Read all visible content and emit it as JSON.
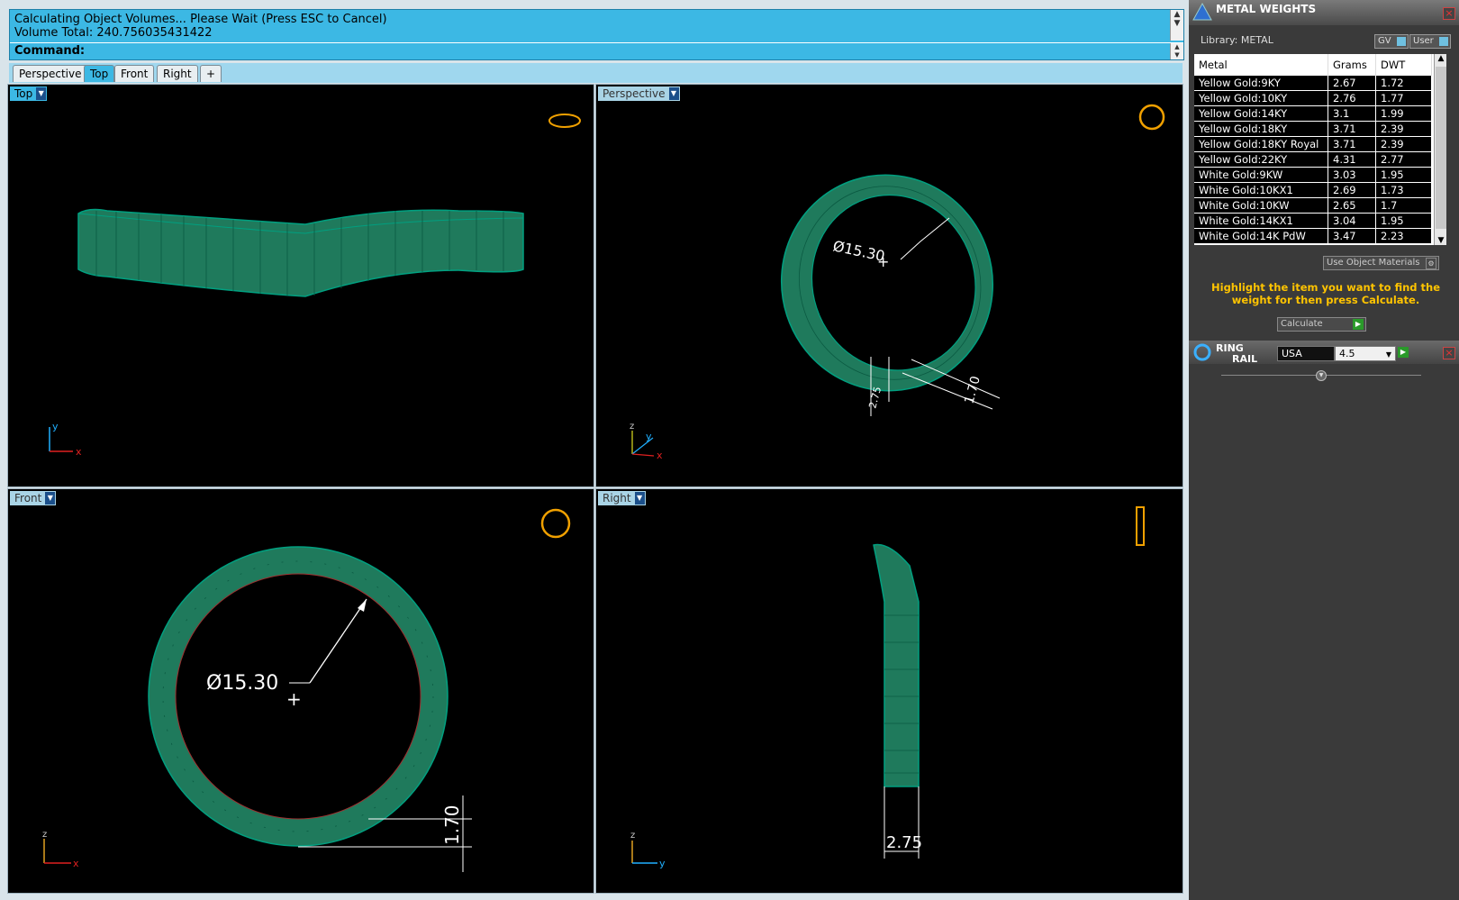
{
  "command": {
    "line1": "Calculating Object Volumes... Please Wait (Press ESC to Cancel)",
    "line2": "Volume Total: 240.756035431422",
    "prompt": "Command:"
  },
  "tabs": [
    "Perspective",
    "Top",
    "Front",
    "Right"
  ],
  "active_tab": "Top",
  "viewports": {
    "top": {
      "label": "Top",
      "axis_y": "y",
      "axis_x": "x"
    },
    "perspective": {
      "label": "Perspective",
      "axis_z": "z",
      "axis_y": "y",
      "axis_x": "x",
      "dim_diameter": "Ø15.30",
      "dim_a": "2.75",
      "dim_b": "1.70"
    },
    "front": {
      "label": "Front",
      "axis_z": "z",
      "axis_x": "x",
      "dim_diameter": "Ø15.30",
      "dim_thickness": "1.70"
    },
    "right": {
      "label": "Right",
      "axis_z": "z",
      "axis_y": "y",
      "dim_width": "2.75"
    }
  },
  "colors": {
    "model": "#1e8a6a",
    "wire": "#00a080",
    "accent": "#3cb8e4",
    "hint": "#ffc400"
  },
  "metal_weights": {
    "title": "METAL WEIGHTS",
    "library": "Library: METAL",
    "gv_label": "GV",
    "user_label": "User",
    "columns": [
      "Metal",
      "Grams",
      "DWT"
    ],
    "rows": [
      [
        "Yellow Gold:9KY",
        "2.67",
        "1.72"
      ],
      [
        "Yellow Gold:10KY",
        "2.76",
        "1.77"
      ],
      [
        "Yellow Gold:14KY",
        "3.1",
        "1.99"
      ],
      [
        "Yellow Gold:18KY",
        "3.71",
        "2.39"
      ],
      [
        "Yellow Gold:18KY Royal",
        "3.71",
        "2.39"
      ],
      [
        "Yellow Gold:22KY",
        "4.31",
        "2.77"
      ],
      [
        "White Gold:9KW",
        "3.03",
        "1.95"
      ],
      [
        "White Gold:10KX1",
        "2.69",
        "1.73"
      ],
      [
        "White Gold:10KW",
        "2.65",
        "1.7"
      ],
      [
        "White Gold:14KX1",
        "3.04",
        "1.95"
      ],
      [
        "White Gold:14K PdW",
        "3.47",
        "2.23"
      ]
    ],
    "use_object_materials": "Use Object Materials",
    "hint": "Highlight the item you want to find the weight for then press Calculate.",
    "calculate": "Calculate"
  },
  "ring_rail": {
    "title_1": "RING",
    "title_2": "RAIL",
    "standard": "USA",
    "size": "4.5"
  }
}
